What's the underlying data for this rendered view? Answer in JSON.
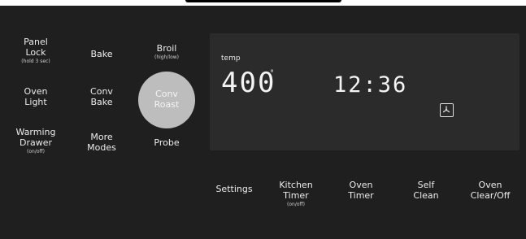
{
  "left_keys": [
    {
      "label": "Panel\nLock",
      "sub": "(hold 3 sec)"
    },
    {
      "label": "Oven\nLight",
      "sub": ""
    },
    {
      "label": "Warming\nDrawer",
      "sub": "(on/off)"
    }
  ],
  "mid_keys": [
    {
      "label": "Bake",
      "sub": ""
    },
    {
      "label": "Conv\nBake",
      "sub": ""
    },
    {
      "label": "More\nModes",
      "sub": ""
    }
  ],
  "right_keys": [
    {
      "label": "Broil",
      "sub": "(high/low)"
    },
    {
      "label": "Conv\nRoast",
      "sub": ""
    },
    {
      "label": "Probe",
      "sub": ""
    }
  ],
  "display": {
    "temp_label": "temp",
    "temp_value": "400",
    "degree": "°",
    "clock": "12:36",
    "fan_icon": "fan-icon"
  },
  "bottom_keys": [
    {
      "label": "Settings",
      "sub": ""
    },
    {
      "label": "Kitchen\nTimer",
      "sub": "(on/off)"
    },
    {
      "label": "Oven\nTimer",
      "sub": ""
    },
    {
      "label": "Self\nClean",
      "sub": ""
    },
    {
      "label": "Oven\nClear/Off",
      "sub": ""
    }
  ],
  "colors": {
    "background": "#1f1f1f",
    "display": "#2b2b2b",
    "selected_circle": "#bdbdbd"
  }
}
